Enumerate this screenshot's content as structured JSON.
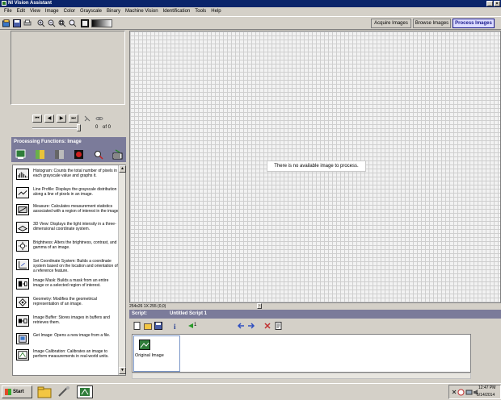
{
  "window": {
    "title": "NI Vision Assistant",
    "min_glyph": "_",
    "close_glyph": "×"
  },
  "menu": [
    "File",
    "Edit",
    "View",
    "Image",
    "Color",
    "Grayscale",
    "Binary",
    "Machine Vision",
    "Identification",
    "Tools",
    "Help"
  ],
  "mode_tabs": [
    {
      "label": "Acquire Images",
      "active": false
    },
    {
      "label": "Browse Images",
      "active": false
    },
    {
      "label": "Process Images",
      "active": true
    }
  ],
  "navigator": {
    "buttons": [
      "⏮",
      "◀",
      "▶",
      "⏭"
    ],
    "current_frame": "0",
    "of_label": "of 0"
  },
  "processing_functions": {
    "header": "Processing Functions: Image",
    "categories": [
      "image-category-icon",
      "color-category-icon",
      "grayscale-category-icon",
      "binary-category-icon",
      "machine-vision-category-icon",
      "identification-category-icon"
    ],
    "items": [
      {
        "icon": "histogram-icon",
        "text": "Histogram:  Counts the total number of pixels in each grayscale value and graphs it."
      },
      {
        "icon": "line-profile-icon",
        "text": "Line Profile:  Displays the grayscale distribution along a line of pixels in an image."
      },
      {
        "icon": "measure-icon",
        "text": "Measure:  Calculates measurement statistics associated with a region of interest in the image."
      },
      {
        "icon": "3d-view-icon",
        "text": "3D View:  Displays the light intensity in a three-dimensional coordinate system."
      },
      {
        "icon": "brightness-icon",
        "text": "Brightness:  Alters the brightness, contrast, and gamma of an image."
      },
      {
        "icon": "coordinate-system-icon",
        "text": "Set Coordinate System:  Builds a coordinate system based on the location and orientation of a reference feature."
      },
      {
        "icon": "image-mask-icon",
        "text": "Image Mask:  Builds a mask from an entire image or a selected region of interest."
      },
      {
        "icon": "geometry-icon",
        "text": "Geometry:  Modifies the geometrical representation of an image."
      },
      {
        "icon": "image-buffer-icon",
        "text": "Image Buffer:  Stores images in buffers and retrieves them."
      },
      {
        "icon": "get-image-icon",
        "text": "Get Image:  Opens a new image from a file."
      },
      {
        "icon": "image-calibration-icon",
        "text": "Image Calibration:  Calibrates an image to perform measurements in real-world units."
      }
    ]
  },
  "image_area": {
    "message": "There is no available image to process.",
    "status": "254x26 1X 255   (0,0)"
  },
  "script": {
    "header_left": "Script:",
    "title": "Untitled Script 1",
    "step_label": "Original Image",
    "step_counter": "1"
  },
  "taskbar": {
    "start_label": "Start",
    "time": "12:47 PM",
    "date": "5/14/2014"
  }
}
